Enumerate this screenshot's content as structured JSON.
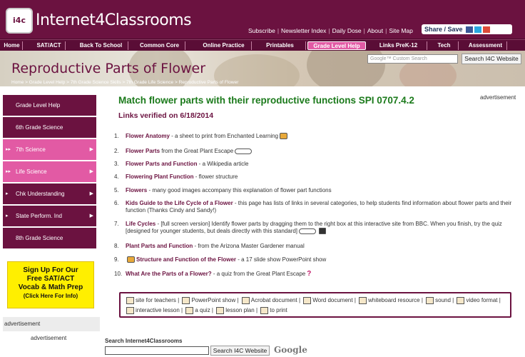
{
  "header": {
    "logo_text": "i4c",
    "brand": "Internet4Classrooms",
    "top_links": [
      "Subscribe",
      "Newsletter Index",
      "Daily Dose",
      "About",
      "Site Map"
    ],
    "share_label": "Share / Save"
  },
  "nav": {
    "items": [
      "Home",
      "SAT/ACT",
      "Back To School",
      "Common Core",
      "Online Practice",
      "Printables",
      "Grade Level Help",
      "Links PreK-12",
      "Tech",
      "Assessment"
    ],
    "active": "Grade Level Help"
  },
  "banner": {
    "title": "Reproductive Parts of Flower",
    "search_placeholder": "Google™ Custom Search",
    "search_button": "Search I4C Website",
    "breadcrumb": [
      "Home",
      "Grade Level Help",
      "7th Grade Science Skills",
      "7th Grade Life Science",
      "Reproductive Parts of Flower"
    ]
  },
  "sidebar": {
    "items": [
      {
        "label": "Grade Level Help",
        "style": "dark",
        "arrow": false,
        "lead": ""
      },
      {
        "label": "6th Grade Science",
        "style": "dark",
        "arrow": false,
        "lead": ""
      },
      {
        "label": "7th Science",
        "style": "pink",
        "arrow": true,
        "lead": "▸▸"
      },
      {
        "label": "Life Science",
        "style": "pink",
        "arrow": true,
        "lead": "▸▸"
      },
      {
        "label": "Chk Understanding",
        "style": "dark",
        "arrow": true,
        "lead": "▸"
      },
      {
        "label": "State Perform. Ind",
        "style": "dark",
        "arrow": true,
        "lead": "▸"
      },
      {
        "label": "8th Grade Science",
        "style": "dark",
        "arrow": false,
        "lead": ""
      }
    ],
    "promo": [
      "Sign Up For Our",
      "Free SAT/ACT",
      "Vocab & Math Prep",
      "(Click Here For Info)"
    ],
    "advertisement": "advertisement"
  },
  "main": {
    "title": "Match flower parts with their reproductive functions SPI 0707.4.2",
    "verified": "Links verified on 6/18/2014",
    "advertisement": "advertisement",
    "items": [
      {
        "num": "1.",
        "link": "Flower Anatomy",
        "text": " - a sheet to print from Enchanted Learning",
        "icons": [
          "printer-icon"
        ]
      },
      {
        "num": "2.",
        "link": "Flower Parts",
        "text": " from the Great Plant Escape",
        "icons": [
          "interactive-lesson-icon"
        ]
      },
      {
        "num": "3.",
        "link": "Flower Parts and Function",
        "text": " - a Wikipedia article",
        "icons": []
      },
      {
        "num": "4.",
        "link": "Flowering Plant Function",
        "text": " - flower structure",
        "icons": []
      },
      {
        "num": "5.",
        "link": "Flowers",
        "text": " - many good images accompany this explanation of flower part functions",
        "icons": []
      },
      {
        "num": "6.",
        "link": "Kids Guide to the Life Cycle of a Flower",
        "text": " - this page has lists of links in several categories, to help students find information about flower parts and their function (Thanks Cindy and Sandy!)",
        "icons": []
      },
      {
        "num": "7.",
        "link": "Life Cycles",
        "text": " - [full screen version] Identify flower parts by dragging them to the right box at this interactive site from BBC. When you finish, try the quiz [designed for younger students, but deals directly with this standard]",
        "icons": [
          "interactive-lesson-icon",
          "sound-icon"
        ]
      },
      {
        "num": "8.",
        "link": "Plant Parts and Function",
        "text": " - from the Arizona Master Gardener manual",
        "icons": []
      },
      {
        "num": "9.",
        "link": "Structure and Function of the Flower",
        "text": " - a 17 slide show PowerPoint show",
        "icons": [
          "powerpoint-icon"
        ]
      },
      {
        "num": "10.",
        "link": "What Are the Parts of a Flower?",
        "text": " - a quiz from the Great Plant Escape",
        "icons": [
          "quiz-icon"
        ]
      }
    ],
    "legend": [
      "site for teachers",
      "PowerPoint show",
      "Acrobat document",
      "Word document",
      "whiteboard resource",
      "sound",
      "video format",
      "interactive lesson",
      "a quiz",
      "lesson plan",
      "to print"
    ]
  },
  "bottom": {
    "search_label": "Search Internet4Classrooms",
    "search_button": "Search I4C Website",
    "google_logo": "Google"
  }
}
